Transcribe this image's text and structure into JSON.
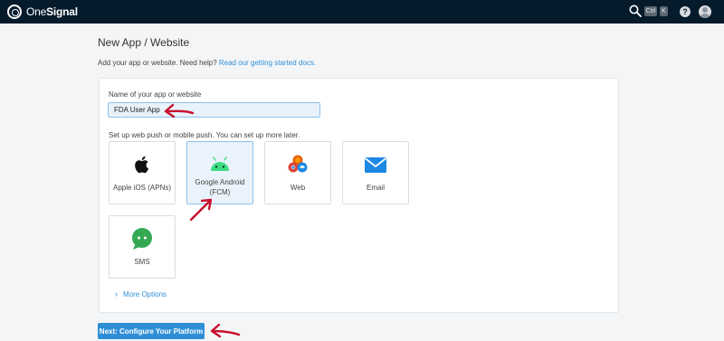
{
  "header": {
    "logo": {
      "word1": "One",
      "word2": "Signal"
    },
    "search_icon": "search-icon",
    "shortcut": {
      "ctrl": "Ctrl",
      "key": "K"
    },
    "help_label": "?",
    "avatar_icon": "user-avatar-icon",
    "bg_color": "#051b2c"
  },
  "page": {
    "title": "New App / Website",
    "help_text": "Add your app or website. Need help?",
    "help_link": "Read our getting started docs."
  },
  "form": {
    "name_label": "Name of your app or website",
    "name_value": "FDA User App",
    "setup_label": "Set up web push or mobile push. You can set up more later.",
    "platforms": [
      {
        "label": "Apple iOS (APNs)",
        "icon": "apple-icon",
        "selected": false
      },
      {
        "label": "Google Android (FCM)",
        "icon": "android-icon",
        "selected": true
      },
      {
        "label": "Web",
        "icon": "browsers-icon",
        "selected": false
      },
      {
        "label": "Email",
        "icon": "envelope-icon",
        "selected": false
      },
      {
        "label": "SMS",
        "icon": "chat-bubble-icon",
        "selected": false
      }
    ],
    "more_options": "More Options"
  },
  "actions": {
    "next_label": "Next: Configure Your Platform"
  },
  "colors": {
    "accent": "#2f8fd6",
    "annotation_arrow": "#c8102e",
    "android_green": "#3ddc84"
  }
}
